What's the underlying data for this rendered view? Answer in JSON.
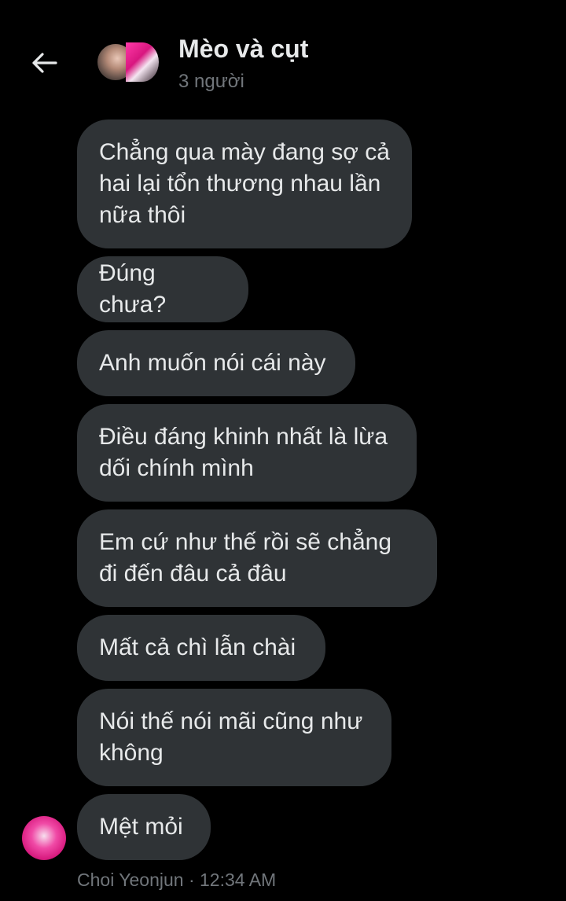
{
  "header": {
    "title": "Mèo và cụt",
    "subtitle": "3 người",
    "back_icon": "arrow-left-icon"
  },
  "messages": [
    {
      "text": "Chẳng qua mày đang sợ cả hai lại tổn thương nhau lần nữa thôi"
    },
    {
      "text": "Đúng chưa?"
    },
    {
      "text": "Anh muốn nói cái này"
    },
    {
      "text": "Điều đáng khinh nhất là lừa dối chính mình"
    },
    {
      "text": "Em cứ như thế rồi sẽ chẳng đi đến đâu cả đâu"
    },
    {
      "text": "Mất cả chì lẫn chài"
    },
    {
      "text": "Nói thế nói mãi cũng như không"
    },
    {
      "text": "Mệt mỏi"
    }
  ],
  "footer": {
    "sender_time": "Choi Yeonjun · 12:34 AM"
  },
  "colors": {
    "background": "#000000",
    "bubble": "#2f3336",
    "text": "#e7e9ea",
    "muted": "#71767b"
  }
}
